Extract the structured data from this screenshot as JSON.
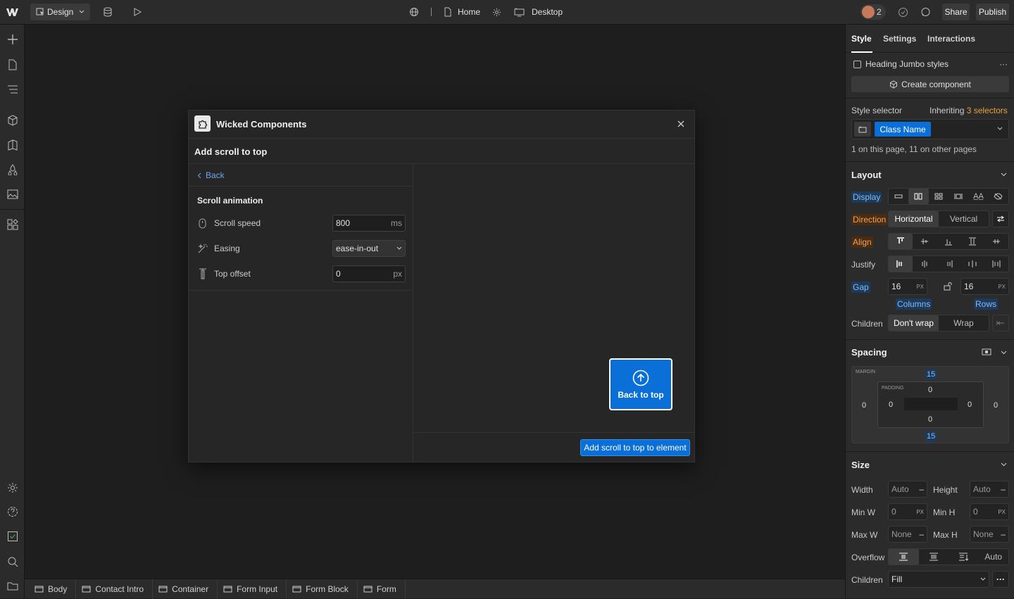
{
  "topbar": {
    "mode_label": "Design",
    "page_name": "Home",
    "breakpoint": "Desktop",
    "collaborator_count": "2",
    "share_label": "Share",
    "publish_label": "Publish"
  },
  "modal": {
    "app_name": "Wicked Components",
    "subtitle": "Add scroll to top",
    "back_label": "Back",
    "section_title": "Scroll animation",
    "fields": {
      "scroll_speed": {
        "label": "Scroll speed",
        "value": "800",
        "unit": "ms"
      },
      "easing": {
        "label": "Easing",
        "value": "ease-in-out"
      },
      "top_offset": {
        "label": "Top offset",
        "value": "0",
        "unit": "px"
      }
    },
    "preview_button_label": "Back to top",
    "add_button_label": "Add scroll to top to element"
  },
  "breadcrumb": [
    "Body",
    "Contact Intro",
    "Container",
    "Form Input",
    "Form Block",
    "Form"
  ],
  "panel": {
    "tabs": [
      "Style",
      "Settings",
      "Interactions"
    ],
    "active_tab": "Style",
    "heading_styles_label": "Heading Jumbo styles",
    "create_component_label": "Create component",
    "style_selector_label": "Style selector",
    "inheriting_prefix": "Inheriting",
    "inheriting_link": "3 selectors",
    "class_name": "Class Name",
    "usage_text": "1 on this page, 11 on other pages",
    "layout": {
      "title": "Layout",
      "display_label": "Display",
      "direction_label": "Direction",
      "direction_options": [
        "Horizontal",
        "Vertical"
      ],
      "align_label": "Align",
      "justify_label": "Justify",
      "gap_label": "Gap",
      "gap_columns": "16",
      "gap_rows": "16",
      "gap_unit": "PX",
      "columns_label": "Columns",
      "rows_label": "Rows",
      "children_label": "Children",
      "children_options": [
        "Don't wrap",
        "Wrap"
      ]
    },
    "spacing": {
      "title": "Spacing",
      "margin_label": "MARGIN",
      "padding_label": "PADDING",
      "margin_top": "15",
      "margin_bottom": "15",
      "margin_left": "0",
      "margin_right": "0",
      "padding_top": "0",
      "padding_bottom": "0",
      "padding_left": "0",
      "padding_right": "0"
    },
    "size": {
      "title": "Size",
      "width_label": "Width",
      "width_value": "Auto",
      "height_label": "Height",
      "height_value": "Auto",
      "minw_label": "Min W",
      "minw_value": "0",
      "minh_label": "Min H",
      "minh_value": "0",
      "maxw_label": "Max W",
      "maxw_value": "None",
      "maxh_label": "Max H",
      "maxh_value": "None",
      "unit_px": "PX",
      "dash": "–",
      "overflow_label": "Overflow",
      "overflow_auto": "Auto",
      "children_label": "Children",
      "children_value": "Fill"
    }
  },
  "colors": {
    "accent": "#0a6fd6",
    "highlight_orange": "#f0a060",
    "selector_orange": "#e8a33a"
  }
}
